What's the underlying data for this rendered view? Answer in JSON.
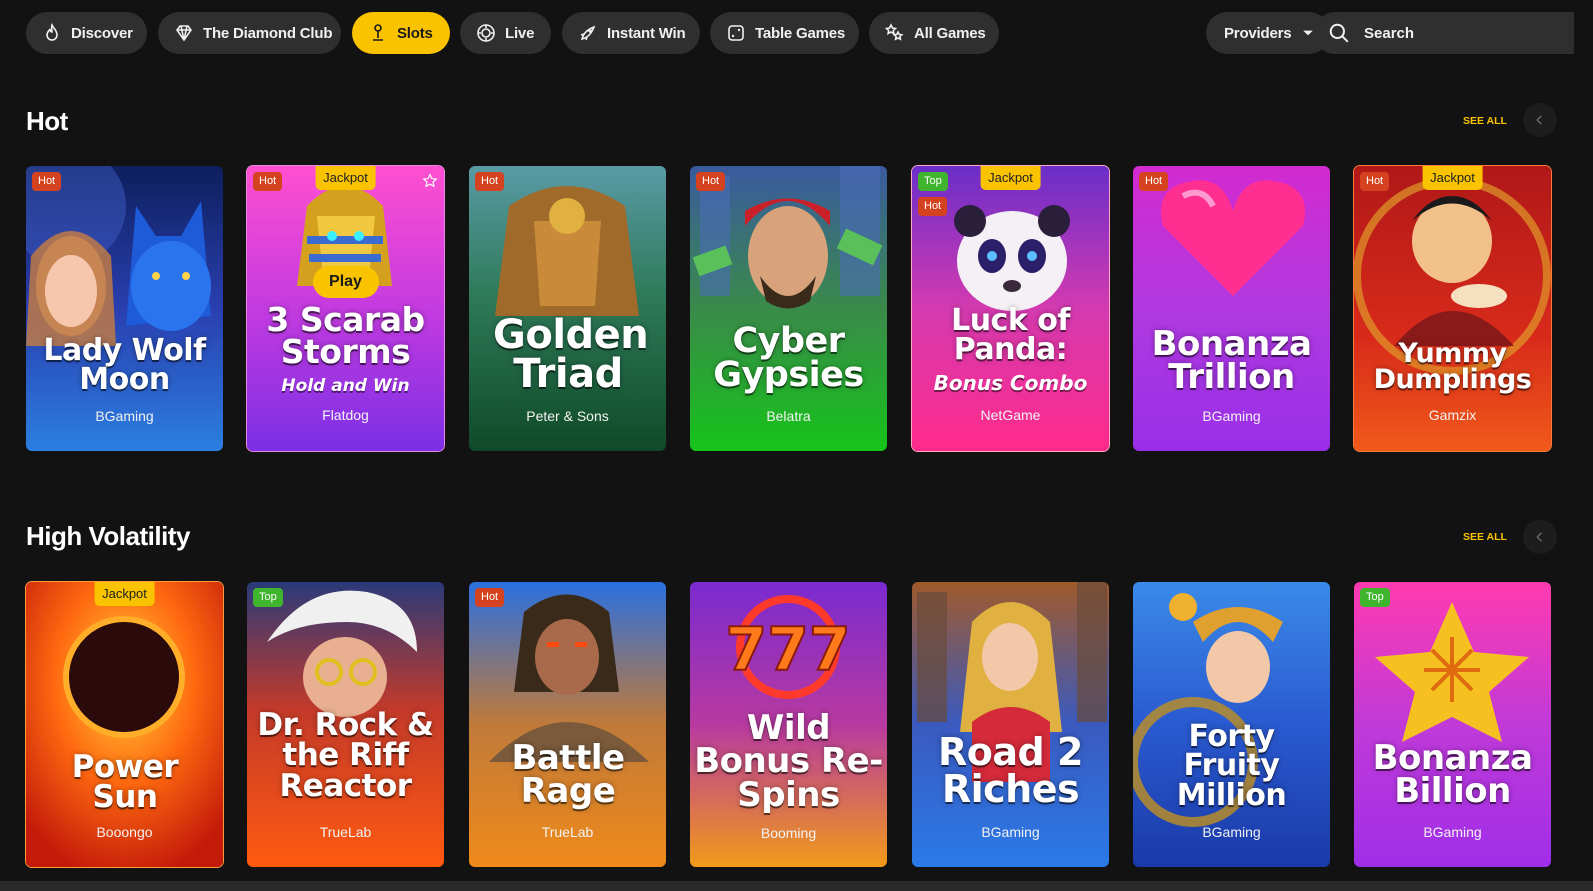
{
  "nav": {
    "categories": [
      {
        "label": "Discover",
        "icon": "flame-icon",
        "active": false
      },
      {
        "label": "The Diamond Club",
        "icon": "diamond-icon",
        "active": false
      },
      {
        "label": "Slots",
        "icon": "joystick-icon",
        "active": true
      },
      {
        "label": "Live",
        "icon": "chip-icon",
        "active": false
      },
      {
        "label": "Instant Win",
        "icon": "rocket-icon",
        "active": false
      },
      {
        "label": "Table Games",
        "icon": "dice-icon",
        "active": false
      },
      {
        "label": "All Games",
        "icon": "stars-icon",
        "active": false
      }
    ],
    "providers_label": "Providers",
    "search_placeholder": "Search"
  },
  "sections": [
    {
      "title": "Hot",
      "see_all": "SEE ALL",
      "games": [
        {
          "title": "Lady Wolf Moon",
          "provider": "BGaming",
          "badges": [
            "Hot"
          ]
        },
        {
          "title": "3 Scarab Storms",
          "subtitle": "Hold and Win",
          "provider": "Flatdog",
          "badges": [
            "Hot"
          ],
          "jackpot": "Jackpot",
          "play": "Play"
        },
        {
          "title": "Golden Triad",
          "provider": "Peter & Sons",
          "badges": [
            "Hot"
          ]
        },
        {
          "title": "Cyber Gypsies",
          "provider": "Belatra",
          "badges": [
            "Hot"
          ]
        },
        {
          "title": "Luck of Panda:",
          "subtitle": "Bonus Combo",
          "provider": "NetGame",
          "badges": [
            "Top",
            "Hot"
          ],
          "jackpot": "Jackpot"
        },
        {
          "title": "Bonanza Trillion",
          "provider": "BGaming",
          "badges": [
            "Hot"
          ]
        },
        {
          "title": "Yummy Dumplings",
          "provider": "Gamzix",
          "badges": [
            "Hot"
          ],
          "jackpot": "Jackpot"
        }
      ]
    },
    {
      "title": "High Volatility",
      "see_all": "SEE ALL",
      "games": [
        {
          "title": "Power Sun",
          "provider": "Booongo",
          "badges": [],
          "jackpot": "Jackpot"
        },
        {
          "title": "Dr. Rock & the Riff Reactor",
          "provider": "TrueLab",
          "badges": [
            "Top"
          ]
        },
        {
          "title": "Battle Rage",
          "provider": "TrueLab",
          "badges": [
            "Hot"
          ]
        },
        {
          "title": "Wild Bonus Re-Spins",
          "provider": "Booming",
          "badges": []
        },
        {
          "title": "Road 2 Riches",
          "provider": "BGaming",
          "badges": []
        },
        {
          "title": "Forty Fruity Million",
          "provider": "BGaming",
          "badges": []
        },
        {
          "title": "Bonanza Billion",
          "provider": "BGaming",
          "badges": [
            "Top"
          ]
        }
      ]
    }
  ],
  "colors": {
    "accent": "#f9c300",
    "background": "#121212",
    "pill": "#2f2f2f",
    "hot": "#d4421f",
    "top": "#3fb52d"
  }
}
